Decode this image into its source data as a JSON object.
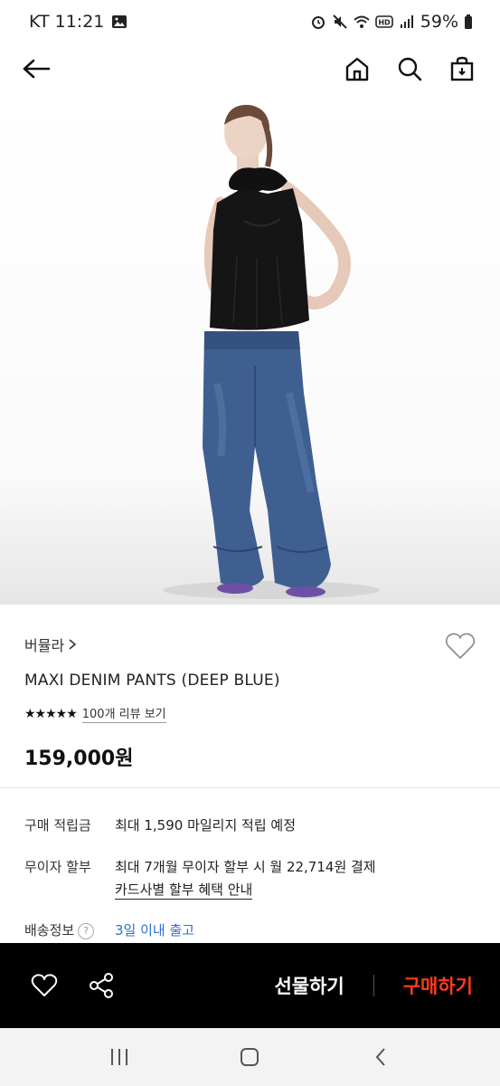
{
  "status": {
    "carrier_time": "KT 11:21",
    "battery": "59%"
  },
  "product": {
    "brand": "버뮬라",
    "name": "MAXI DENIM PANTS (DEEP BLUE)",
    "rating_stars": "★★★★★",
    "review_link": "100개 리뷰 보기",
    "price": "159,000원"
  },
  "details": {
    "points_label": "구매 적립금",
    "points_value": "최대 1,590 마일리지 적립 예정",
    "installment_label": "무이자 할부",
    "installment_value": "최대 7개월 무이자 할부 시 월 22,714원 결제",
    "installment_link": "카드사별 할부 혜택 안내",
    "shipping_label": "배송정보",
    "shipping_help": "?",
    "shipping_value": "3일 이내 출고"
  },
  "actions": {
    "gift": "선물하기",
    "buy": "구매하기"
  },
  "colors": {
    "buy_accent": "#ff3b1f",
    "shipping_blue": "#2b6fd0",
    "bottom_bar": "#000000"
  }
}
